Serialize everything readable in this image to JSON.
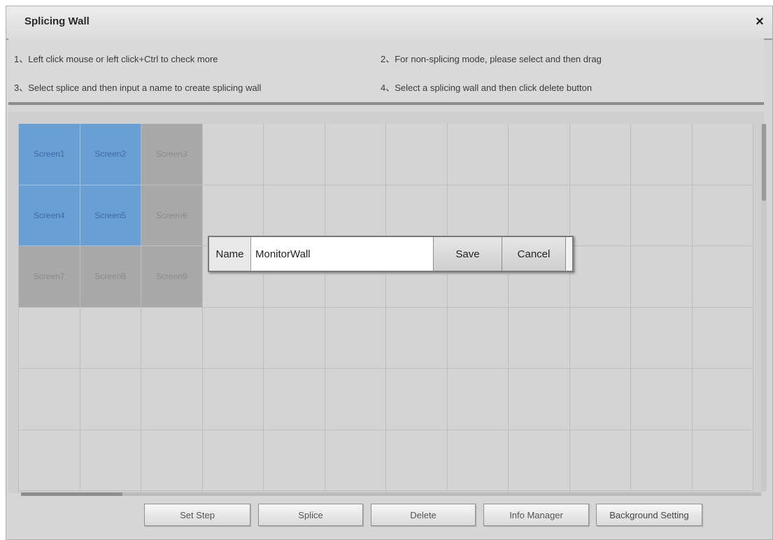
{
  "window": {
    "title": "Splicing Wall",
    "close_label": "×"
  },
  "instructions": [
    "1、Left click mouse or left click+Ctrl to check more",
    "2、For non-splicing mode, please select and then drag",
    "3、Select splice and then input a name to create splicing wall",
    "4、Select a splicing wall and then click delete button"
  ],
  "grid": {
    "columns": 12,
    "rows": 6,
    "screens": [
      {
        "label": "Screen1",
        "state": "selected"
      },
      {
        "label": "Screen2",
        "state": "selected"
      },
      {
        "label": "Screen3",
        "state": "grey"
      },
      {
        "label": "Screen4",
        "state": "selected"
      },
      {
        "label": "Screen5",
        "state": "selected"
      },
      {
        "label": "Screen6",
        "state": "grey"
      },
      {
        "label": "Screen7",
        "state": "grey"
      },
      {
        "label": "Screen8",
        "state": "grey"
      },
      {
        "label": "Screen9",
        "state": "grey"
      }
    ]
  },
  "name_popup": {
    "label": "Name",
    "value": "MonitorWall",
    "save_label": "Save",
    "cancel_label": "Cancel"
  },
  "toolbar": {
    "set_step": "Set Step",
    "splice": "Splice",
    "delete": "Delete",
    "info_manager": "Info Manager",
    "background_setting": "Background Setting"
  },
  "colors": {
    "selected_screen": "#6a9fd3",
    "grey_screen": "#a8a8a8",
    "empty_cell": "#d4d4d4"
  }
}
